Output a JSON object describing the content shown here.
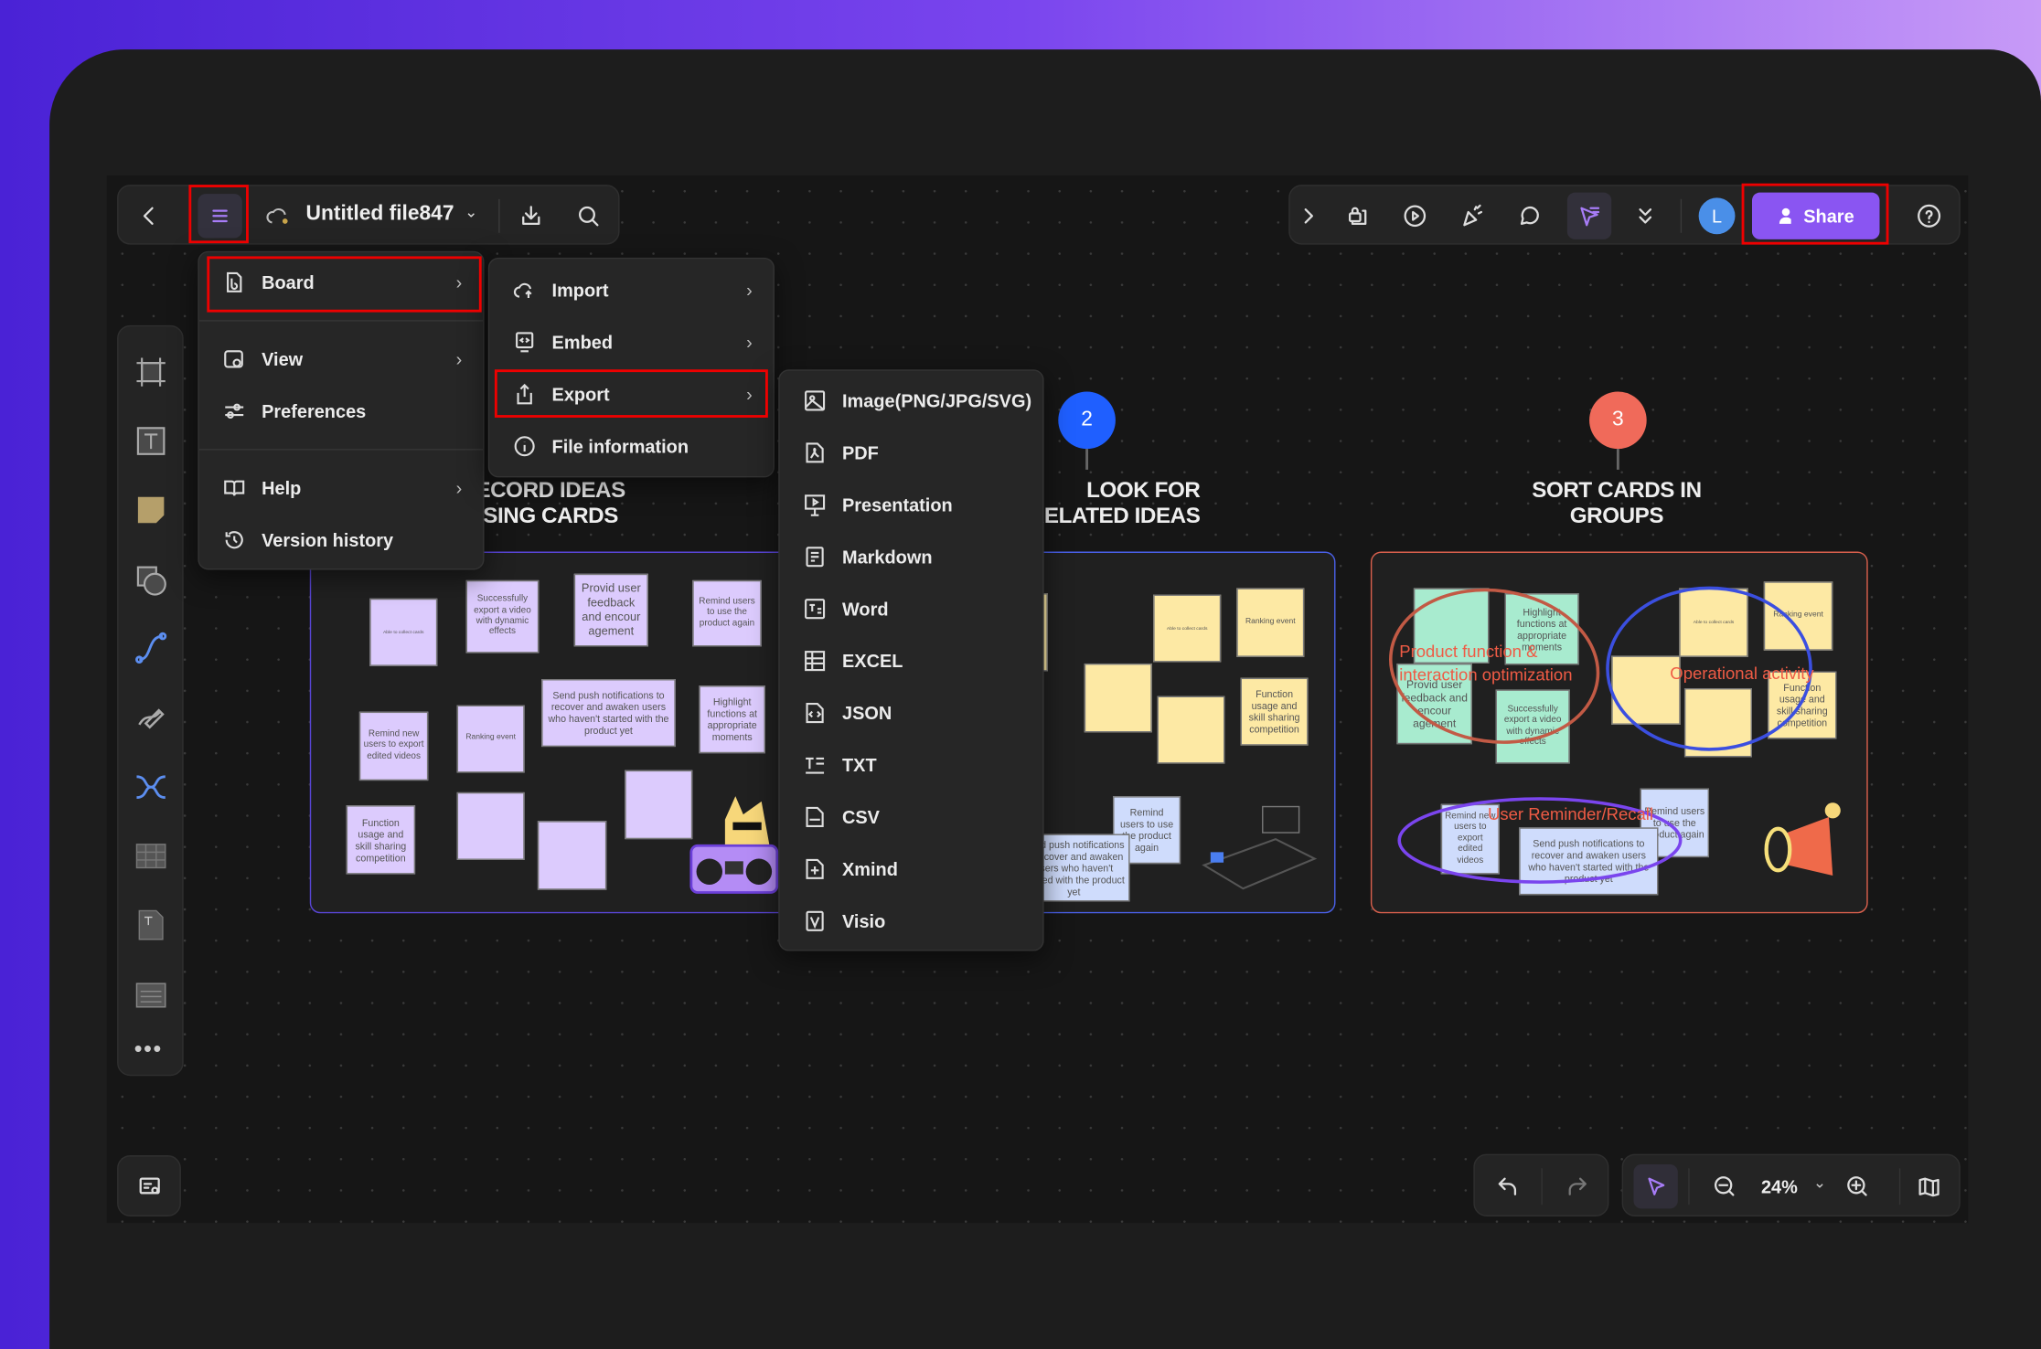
{
  "header": {
    "file_title": "Untitled file847",
    "share_label": "Share",
    "avatar_initial": "L"
  },
  "main_menu": {
    "items": [
      {
        "label": "Board",
        "icon": "board-icon",
        "submenu": true
      },
      {
        "label": "View",
        "icon": "view-icon",
        "submenu": true
      },
      {
        "label": "Preferences",
        "icon": "sliders-icon",
        "submenu": false
      },
      {
        "label": "Help",
        "icon": "book-icon",
        "submenu": true
      },
      {
        "label": "Version history",
        "icon": "history-icon",
        "submenu": false
      }
    ]
  },
  "board_menu": {
    "items": [
      {
        "label": "Import",
        "icon": "cloud-upload-icon"
      },
      {
        "label": "Embed",
        "icon": "embed-icon"
      },
      {
        "label": "Export",
        "icon": "export-icon"
      },
      {
        "label": "File information",
        "icon": "info-icon"
      }
    ]
  },
  "export_menu": {
    "items": [
      "Image(PNG/JPG/SVG)",
      "PDF",
      "Presentation",
      "Markdown",
      "Word",
      "EXCEL",
      "JSON",
      "TXT",
      "CSV",
      "Xmind",
      "Visio"
    ]
  },
  "zoom": {
    "level": "24%"
  },
  "colors": {
    "accent": "#8b5cf6",
    "share": "#8a55f2",
    "highlight": "#e00000",
    "step2": "#1f5fff",
    "step3": "#f06a5a"
  },
  "board": {
    "steps": [
      {
        "number": "2"
      },
      {
        "number": "3"
      }
    ],
    "titles": {
      "t1a": "RECORD IDEAS",
      "t1b": "USING CARDS",
      "t2a": "LOOK FOR",
      "t2b": "RELATED IDEAS",
      "t3a": "SORT CARDS IN",
      "t3b": "GROUPS"
    },
    "notes": {
      "collect": "Able to collect cards",
      "export_video": "Successfully export a video with dynamic effects",
      "feedback": "Provid user feedback and encour agement",
      "remind_again": "Remind users to use the product again",
      "remind_new": "Remind new users to export edited videos",
      "ranking": "Ranking event",
      "push": "Send push notifications to recover and awaken users who haven't started with the product yet",
      "highlight": "Highlight functions at appropriate moments",
      "competition": "Function usage and skill sharing competition"
    },
    "groups": {
      "g1": "Product function & interaction optimization",
      "g2": "Operational activity",
      "g3": "User Reminder/Recall"
    }
  }
}
